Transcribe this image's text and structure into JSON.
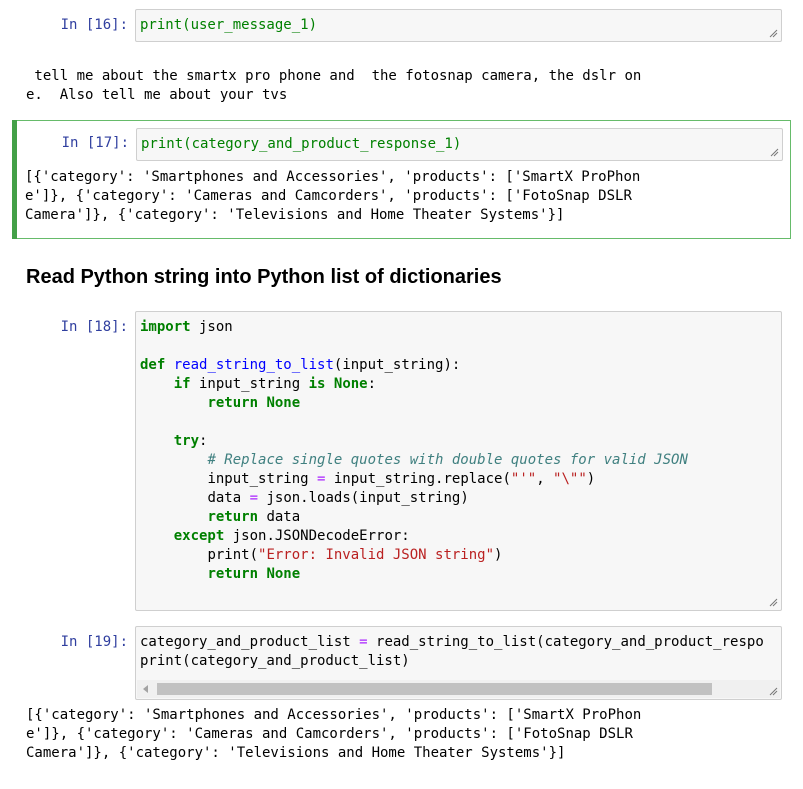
{
  "cells": [
    {
      "prompt": "In [16]:",
      "code": "print(user_message_1)"
    },
    {
      "output": " tell me about the smartx pro phone and  the fotosnap camera, the dslr on\ne.  Also tell me about your tvs"
    },
    {
      "prompt": "In [17]:",
      "code": "print(category_and_product_response_1)",
      "output": "[{'category': 'Smartphones and Accessories', 'products': ['SmartX ProPhon\ne']}, {'category': 'Cameras and Camcorders', 'products': ['FotoSnap DSLR\nCamera']}, {'category': 'Televisions and Home Theater Systems'}]"
    },
    {
      "heading": "Read Python string into Python list of dictionaries"
    },
    {
      "prompt": "In [18]:"
    },
    {
      "prompt": "In [19]:",
      "output": "[{'category': 'Smartphones and Accessories', 'products': ['SmartX ProPhon\ne']}, {'category': 'Cameras and Camcorders', 'products': ['FotoSnap DSLR\nCamera']}, {'category': 'Televisions and Home Theater Systems'}]"
    }
  ],
  "code18": {
    "l1": "import",
    "l1b": " json",
    "l3a": "def",
    "l3b": "read_string_to_list",
    "l3c": "(input_string):",
    "l4": "if",
    "l4b": " input_string ",
    "l4c": "is",
    "l4d": "None",
    "l5": "return",
    "l5b": "None",
    "l7": "try",
    "l8": "# Replace single quotes with double quotes for valid JSON",
    "l9a": "input_string ",
    "l9b": "=",
    "l9c": " input_string.replace(",
    "l9d": "\"'\"",
    "l9e": ", ",
    "l9f": "\"\\\"\"",
    "l9g": ")",
    "l10a": "data ",
    "l10b": "=",
    "l10c": " json.loads(input_string)",
    "l11a": "return",
    "l11b": " data",
    "l12a": "except",
    "l12b": " json.JSONDecodeError:",
    "l13a": "print(",
    "l13b": "\"Error: Invalid JSON string\"",
    "l13c": ")",
    "l14a": "return",
    "l14b": "None"
  },
  "code19": {
    "l1a": "category_and_product_list ",
    "l1b": "=",
    "l1c": " read_string_to_list(category_and_product_respo",
    "l2": "print(category_and_product_list)"
  },
  "colors": {
    "prompt": "#303f9f",
    "keyword": "#008000",
    "function": "#0000ff",
    "string": "#ba2121",
    "comment": "#408080",
    "selected_border": "#43a047"
  },
  "icons": {
    "resize": "resize-handle-icon",
    "scroll_left": "scroll-left-icon"
  }
}
